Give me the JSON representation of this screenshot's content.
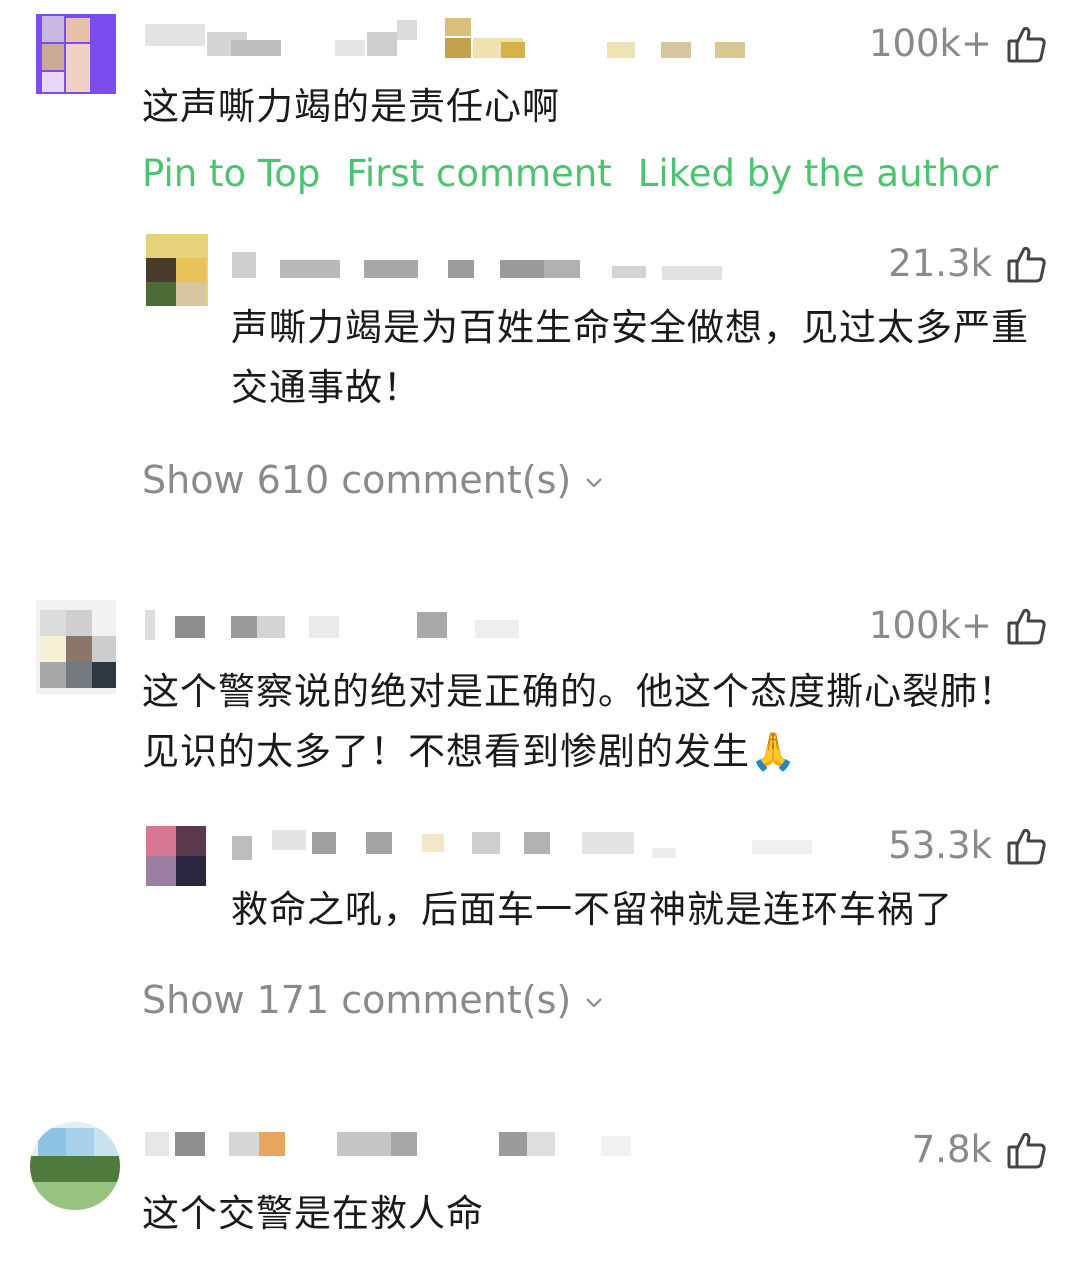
{
  "comments": [
    {
      "likes": "100k+",
      "text": "这声嘶力竭的是责任心啊",
      "tags": [
        "Pin to Top",
        "First comment",
        "Liked by the author"
      ],
      "reply": {
        "likes": "21.3k",
        "text": "声嘶力竭是为百姓生命安全做想，见过太多严重交通事故！"
      },
      "show_more": "Show 610 comment(s)"
    },
    {
      "likes": "100k+",
      "text": "这个警察说的绝对是正确的。他这个态度撕心裂肺！见识的太多了！不想看到惨剧的发生🙏",
      "reply": {
        "likes": "53.3k",
        "text": "救命之吼，后面车一不留神就是连环车祸了"
      },
      "show_more": "Show 171 comment(s)"
    },
    {
      "likes": "7.8k",
      "text": "这个交警是在救人命"
    }
  ],
  "colors": {
    "tag_green": "#4cc36f",
    "meta_gray": "#8a8a8a",
    "text": "#1a1a1a"
  },
  "icons": [
    "thumbs-up-icon",
    "chevron-down-icon"
  ]
}
